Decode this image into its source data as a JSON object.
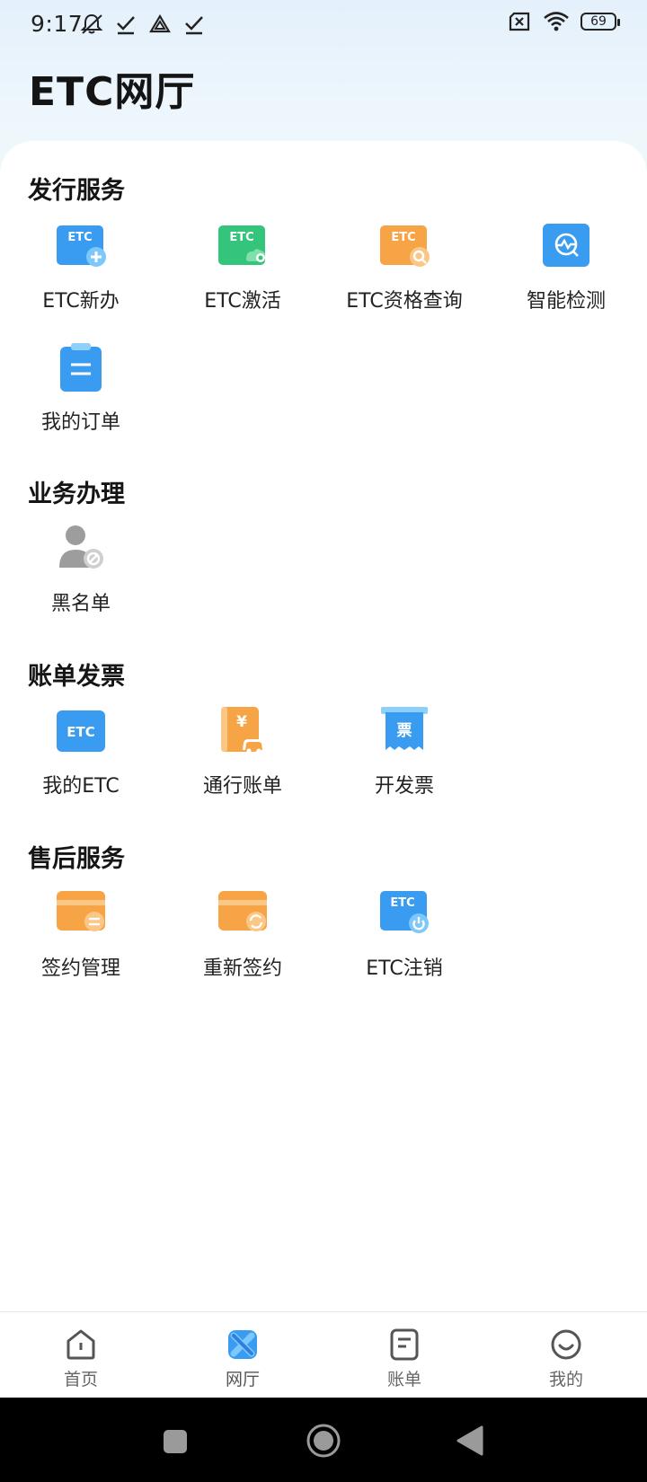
{
  "status_bar": {
    "time": "9:17",
    "battery": "69",
    "icons": [
      "mute-icon",
      "check-icon",
      "drive-icon",
      "check-icon",
      "sim-off-icon",
      "wifi-icon",
      "battery-icon"
    ]
  },
  "page_title": "ETC网厅",
  "sections": [
    {
      "title": "发行服务",
      "items": [
        {
          "label": "ETC新办",
          "icon": "etc-new-icon"
        },
        {
          "label": "ETC激活",
          "icon": "etc-activate-icon"
        },
        {
          "label": "ETC资格查询",
          "icon": "etc-query-icon"
        },
        {
          "label": "智能检测",
          "icon": "smart-detect-icon"
        },
        {
          "label": "我的订单",
          "icon": "my-orders-icon"
        }
      ]
    },
    {
      "title": "业务办理",
      "items": [
        {
          "label": "黑名单",
          "icon": "blacklist-icon"
        }
      ]
    },
    {
      "title": "账单发票",
      "items": [
        {
          "label": "我的ETC",
          "icon": "my-etc-icon"
        },
        {
          "label": "通行账单",
          "icon": "toll-bill-icon"
        },
        {
          "label": "开发票",
          "icon": "invoice-icon"
        }
      ]
    },
    {
      "title": "售后服务",
      "items": [
        {
          "label": "签约管理",
          "icon": "contract-manage-icon"
        },
        {
          "label": "重新签约",
          "icon": "re-sign-icon"
        },
        {
          "label": "ETC注销",
          "icon": "etc-cancel-icon"
        }
      ]
    }
  ],
  "tabs": [
    {
      "label": "首页",
      "icon": "home-icon"
    },
    {
      "label": "网厅",
      "icon": "hall-icon",
      "active": true
    },
    {
      "label": "账单",
      "icon": "bill-icon"
    },
    {
      "label": "我的",
      "icon": "profile-icon"
    }
  ],
  "colors": {
    "blue": "#3a9cf0",
    "green": "#34c47c",
    "orange": "#f7a447",
    "gray": "#9d9d9d"
  }
}
